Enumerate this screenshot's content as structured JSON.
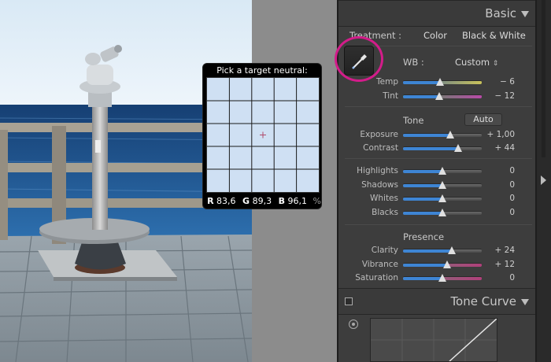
{
  "loupe": {
    "title": "Pick a target neutral:",
    "r_label": "R",
    "r_value": "83,6",
    "g_label": "G",
    "g_value": "89,3",
    "b_label": "B",
    "b_value": "96,1",
    "unit": "%"
  },
  "panel": {
    "basic_title": "Basic",
    "treatment_label": "Treatment :",
    "treatment_color": "Color",
    "treatment_bw": "Black & White",
    "wb_label": "WB :",
    "wb_value": "Custom",
    "tone_title": "Tone",
    "auto_label": "Auto",
    "presence_title": "Presence",
    "tone_curve_title": "Tone Curve",
    "sliders": [
      {
        "label": "Temp",
        "value": "− 6",
        "pos": 0.47
      },
      {
        "label": "Tint",
        "value": "− 12",
        "pos": 0.46
      },
      {
        "label": "Exposure",
        "value": "+ 1,00",
        "pos": 0.6
      },
      {
        "label": "Contrast",
        "value": "+ 44",
        "pos": 0.7
      },
      {
        "label": "Highlights",
        "value": "0",
        "pos": 0.5
      },
      {
        "label": "Shadows",
        "value": "0",
        "pos": 0.5
      },
      {
        "label": "Whites",
        "value": "0",
        "pos": 0.5
      },
      {
        "label": "Blacks",
        "value": "0",
        "pos": 0.5
      },
      {
        "label": "Clarity",
        "value": "+ 24",
        "pos": 0.62
      },
      {
        "label": "Vibrance",
        "value": "+ 12",
        "pos": 0.56
      },
      {
        "label": "Saturation",
        "value": "0",
        "pos": 0.5
      }
    ]
  },
  "colors": {
    "accent_blue": "#3e85d4",
    "highlight_ring": "#d31c8a",
    "panel_bg": "#3d3d3d"
  },
  "icons": [
    "white-balance-eyedropper-icon",
    "collapse-triangle-icon",
    "target-adjustment-icon",
    "panel-switch-icon",
    "scroll-right-arrow-icon"
  ]
}
